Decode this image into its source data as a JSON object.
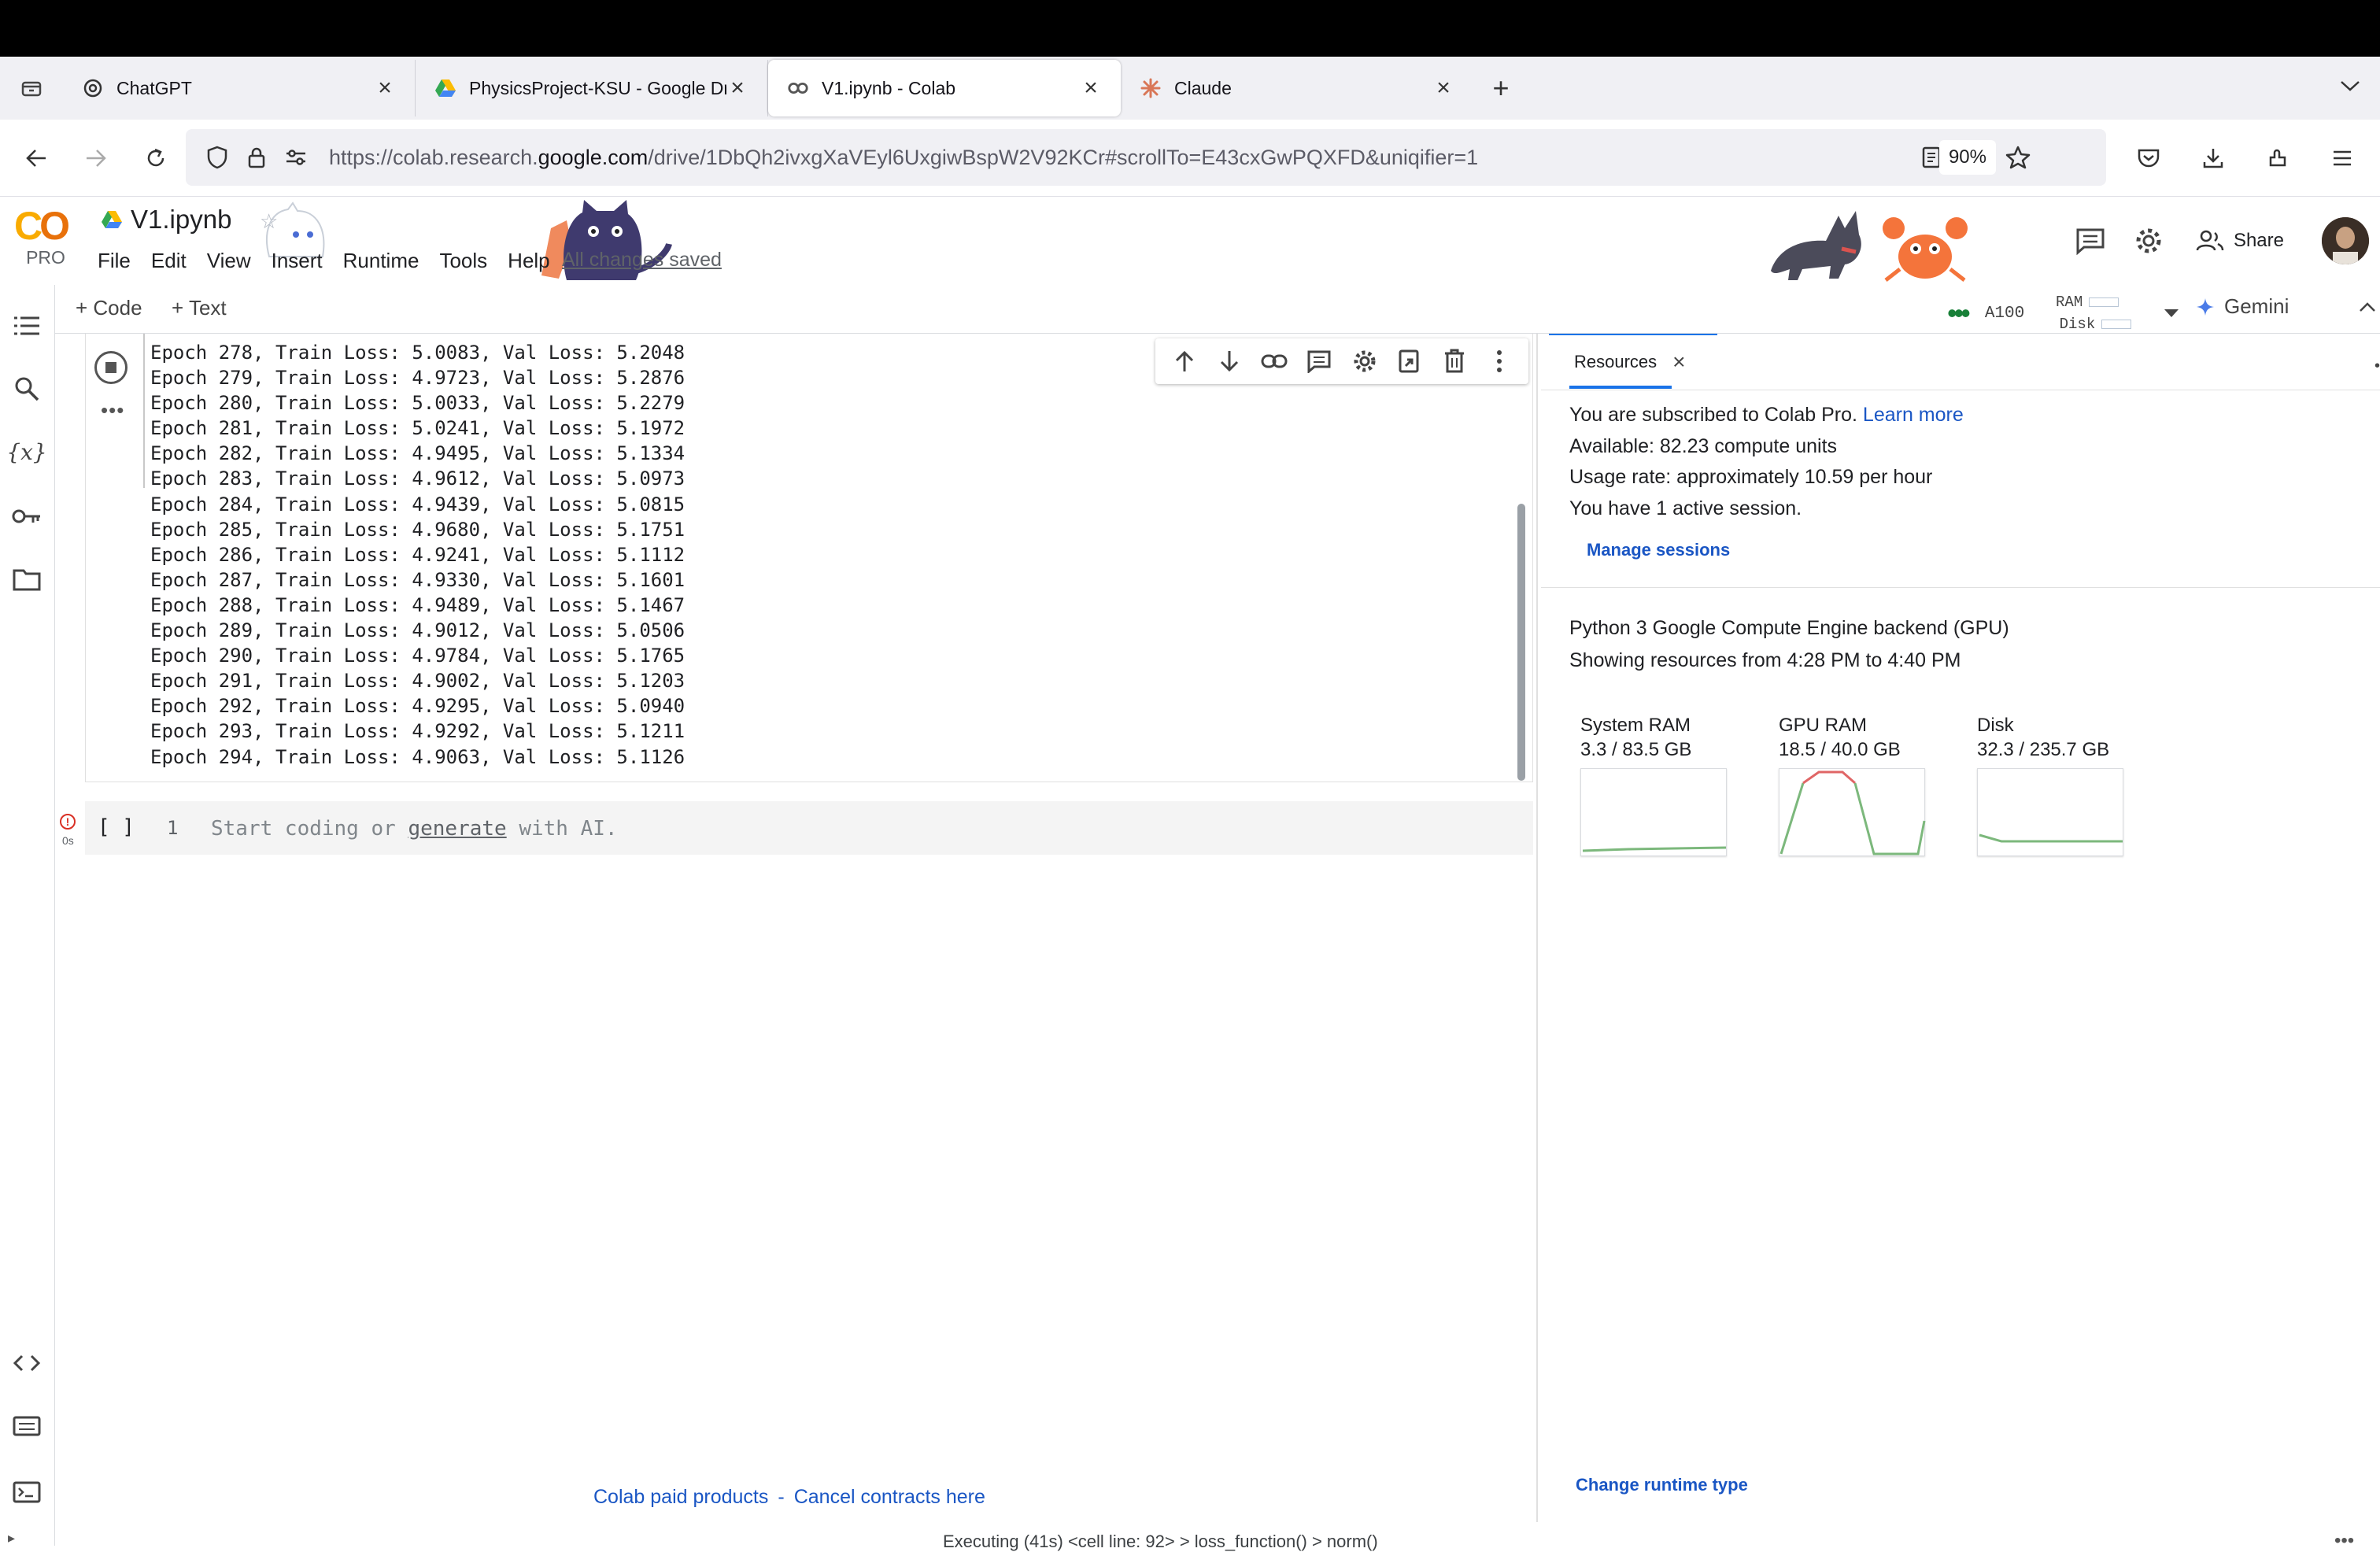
{
  "browser": {
    "tabs": [
      {
        "title": "ChatGPT",
        "active": false
      },
      {
        "title": "PhysicsProject-KSU - Google Dr",
        "active": false
      },
      {
        "title": "V1.ipynb - Colab",
        "active": true
      },
      {
        "title": "Claude",
        "active": false
      }
    ],
    "url_prefix": "https://colab.research.",
    "url_domain": "google.com",
    "url_suffix": "/drive/1DbQh2ivxgXaVEyl6UxgiwBspW2V92KCr#scrollTo=E43cxGwPQXFD&uniqifier=1",
    "zoom": "90%"
  },
  "colab": {
    "logo_text": "PRO",
    "notebook_name": "V1.ipynb",
    "menu": [
      "File",
      "Edit",
      "View",
      "Insert",
      "Runtime",
      "Tools",
      "Help"
    ],
    "save_status": "All changes saved",
    "share_label": "Share",
    "toolbar": {
      "code_label": "+ Code",
      "text_label": "+ Text"
    },
    "runtime": {
      "accelerator": "A100",
      "ram_label": "RAM",
      "disk_label": "Disk"
    },
    "gemini_label": "Gemini"
  },
  "output_lines": [
    "Epoch 278, Train Loss: 5.0083, Val Loss: 5.2048",
    "Epoch 279, Train Loss: 4.9723, Val Loss: 5.2876",
    "Epoch 280, Train Loss: 5.0033, Val Loss: 5.2279",
    "Epoch 281, Train Loss: 5.0241, Val Loss: 5.1972",
    "Epoch 282, Train Loss: 4.9495, Val Loss: 5.1334",
    "Epoch 283, Train Loss: 4.9612, Val Loss: 5.0973",
    "Epoch 284, Train Loss: 4.9439, Val Loss: 5.0815",
    "Epoch 285, Train Loss: 4.9680, Val Loss: 5.1751",
    "Epoch 286, Train Loss: 4.9241, Val Loss: 5.1112",
    "Epoch 287, Train Loss: 4.9330, Val Loss: 5.1601",
    "Epoch 288, Train Loss: 4.9489, Val Loss: 5.1467",
    "Epoch 289, Train Loss: 4.9012, Val Loss: 5.0506",
    "Epoch 290, Train Loss: 4.9784, Val Loss: 5.1765",
    "Epoch 291, Train Loss: 4.9002, Val Loss: 5.1203",
    "Epoch 292, Train Loss: 4.9295, Val Loss: 5.0940",
    "Epoch 293, Train Loss: 4.9292, Val Loss: 5.1211",
    "Epoch 294, Train Loss: 4.9063, Val Loss: 5.1126"
  ],
  "new_cell": {
    "brackets": "[ ]",
    "line_number": "1",
    "placeholder_before": "Start coding or ",
    "placeholder_link": "generate",
    "placeholder_after": " with AI.",
    "exec_time": "0s"
  },
  "footer": {
    "paid_products": "Colab paid products",
    "separator": "-",
    "cancel": "Cancel contracts here"
  },
  "status_bar": "Executing (41s) <cell line: 92> > loss_function() > norm()",
  "resources": {
    "tab_label": "Resources",
    "subscribed": "You are subscribed to Colab Pro.",
    "learn_more": "Learn more",
    "available": "Available: 82.23 compute units",
    "usage_rate": "Usage rate: approximately 10.59 per hour",
    "sessions": "You have 1 active session.",
    "manage_sessions": "Manage sessions",
    "backend": "Python 3 Google Compute Engine backend (GPU)",
    "showing": "Showing resources from 4:28 PM to 4:40 PM",
    "gauges": [
      {
        "name": "System RAM",
        "value": "3.3 / 83.5 GB"
      },
      {
        "name": "GPU RAM",
        "value": "18.5 / 40.0 GB"
      },
      {
        "name": "Disk",
        "value": "32.3 / 235.7 GB"
      }
    ],
    "change_runtime": "Change runtime type"
  },
  "colors": {
    "accent": "#1a73e8",
    "link": "#1a56c4",
    "graph_green": "#7cb87c",
    "graph_red": "#e06666"
  }
}
